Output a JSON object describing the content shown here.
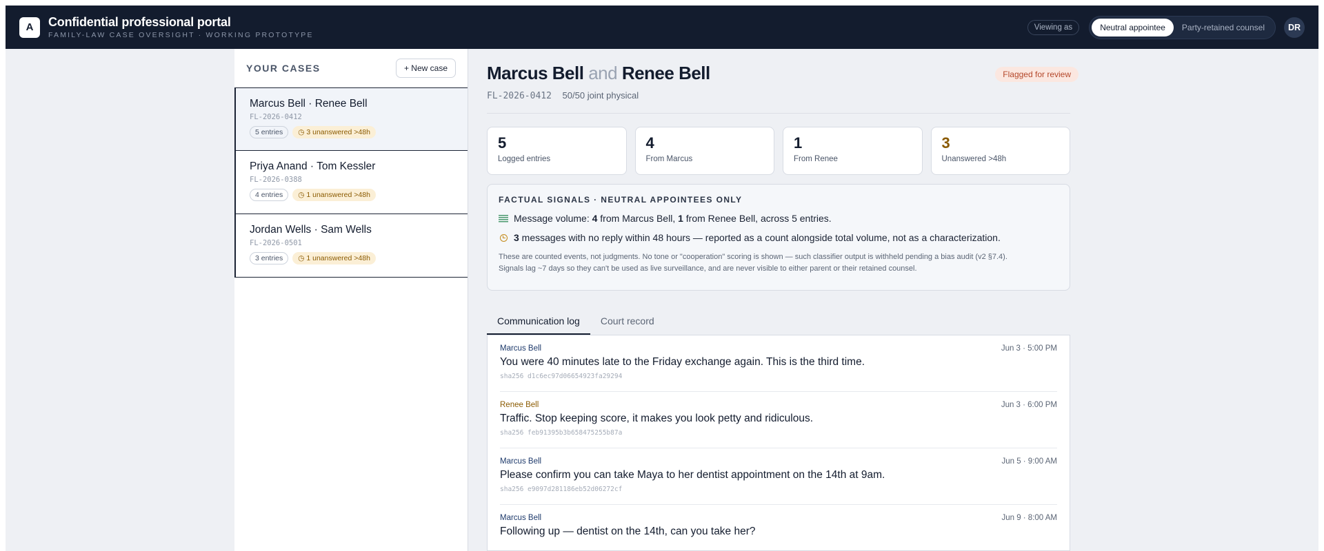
{
  "header": {
    "logo_letter": "A",
    "title": "Confidential professional portal",
    "subtitle": "FAMILY-LAW CASE OVERSIGHT · WORKING PROTOTYPE",
    "viewing_as": "Viewing as",
    "roles": [
      "Neutral appointee",
      "Party-retained counsel"
    ],
    "active_role": "Neutral appointee",
    "avatar_initials": "DR"
  },
  "sidebar": {
    "title": "YOUR CASES",
    "new_case_label": "+ New case",
    "cases": [
      {
        "name": "Marcus Bell · Renee Bell",
        "id": "FL-2026-0412",
        "entries": "5 entries",
        "unanswered": "3 unanswered >48h"
      },
      {
        "name": "Priya Anand · Tom Kessler",
        "id": "FL-2026-0388",
        "entries": "4 entries",
        "unanswered": "1 unanswered >48h"
      },
      {
        "name": "Jordan Wells · Sam Wells",
        "id": "FL-2026-0501",
        "entries": "3 entries",
        "unanswered": "1 unanswered >48h"
      }
    ]
  },
  "case": {
    "party_a": "Marcus Bell",
    "and": "and",
    "party_b": "Renee Bell",
    "id": "FL-2026-0412",
    "arrangement": "50/50 joint physical",
    "flag": "Flagged for review"
  },
  "stats": [
    {
      "value": "5",
      "label": "Logged entries"
    },
    {
      "value": "4",
      "label": "From Marcus"
    },
    {
      "value": "1",
      "label": "From Renee"
    },
    {
      "value": "3",
      "label": "Unanswered >48h"
    }
  ],
  "signals": {
    "title": "FACTUAL SIGNALS · NEUTRAL APPOINTEES ONLY",
    "volume": {
      "prefix": "Message volume: ",
      "a_count": "4",
      "a_text": " from Marcus Bell, ",
      "b_count": "1",
      "b_text": " from Renee Bell, across 5 entries."
    },
    "noreply": {
      "count": "3",
      "text": " messages with no reply within 48 hours — reported as a count alongside total volume, not as a characterization."
    },
    "note_1": "These are counted events, not judgments. No tone or \"cooperation\" scoring is shown — such classifier output is withheld pending a bias audit (v2 §7.4).",
    "note_2": "Signals lag ~7 days so they can't be used as live surveillance, and are never visible to either parent or their retained counsel."
  },
  "tabs": [
    "Communication log",
    "Court record"
  ],
  "messages": [
    {
      "sender": "Marcus Bell",
      "time": "Jun 3 · 5:00 PM",
      "body": "You were 40 minutes late to the Friday exchange again. This is the third time.",
      "hash": "sha256 d1c6ec97d06654923fa29294"
    },
    {
      "sender": "Renee Bell",
      "time": "Jun 3 · 6:00 PM",
      "body": "Traffic. Stop keeping score, it makes you look petty and ridiculous.",
      "hash": "sha256 feb91395b3b658475255b87a"
    },
    {
      "sender": "Marcus Bell",
      "time": "Jun 5 · 9:00 AM",
      "body": "Please confirm you can take Maya to her dentist appointment on the 14th at 9am.",
      "hash": "sha256 e9097d281186eb52d06272cf"
    },
    {
      "sender": "Marcus Bell",
      "time": "Jun 9 · 8:00 AM",
      "body": "Following up — dentist on the 14th, can you take her?",
      "hash": ""
    }
  ]
}
